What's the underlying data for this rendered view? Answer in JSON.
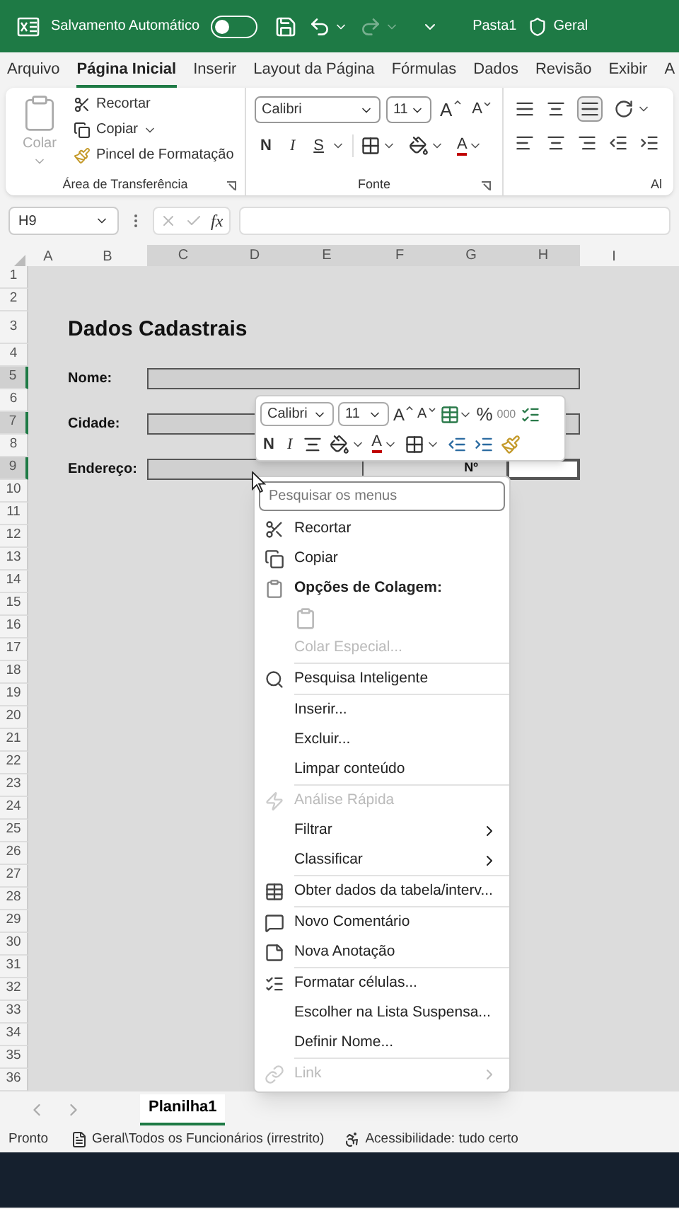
{
  "title_bar": {
    "autosave_label": "Salvamento Automático",
    "autosave_on": false,
    "file_name": "Pasta1",
    "sensitivity_label": "Geral"
  },
  "ribbon_tabs": [
    {
      "label": "Arquivo",
      "selected": false
    },
    {
      "label": "Página Inicial",
      "selected": true
    },
    {
      "label": "Inserir",
      "selected": false
    },
    {
      "label": "Layout da Página",
      "selected": false
    },
    {
      "label": "Fórmulas",
      "selected": false
    },
    {
      "label": "Dados",
      "selected": false
    },
    {
      "label": "Revisão",
      "selected": false
    },
    {
      "label": "Exibir",
      "selected": false
    },
    {
      "label": "A",
      "selected": false
    }
  ],
  "ribbon": {
    "clipboard": {
      "paste": "Colar",
      "paste_disabled": true,
      "cut": "Recortar",
      "copy": "Copiar",
      "format_painter": "Pincel de Formatação",
      "group_label": "Área de Transferência"
    },
    "font": {
      "font_name": "Calibri",
      "font_size": "11",
      "grow": "A",
      "shrink": "A",
      "bold": "N",
      "italic": "I",
      "underline": "S",
      "font_color": "A",
      "group_label": "Fonte"
    },
    "alignment": {
      "group_label": "Al"
    }
  },
  "formula_bar": {
    "name_box": "H9",
    "fx": "fx"
  },
  "columns": [
    {
      "label": "A",
      "selected": false
    },
    {
      "label": "B",
      "selected": false
    },
    {
      "label": "C",
      "selected": true
    },
    {
      "label": "D",
      "selected": true
    },
    {
      "label": "E",
      "selected": true
    },
    {
      "label": "F",
      "selected": true
    },
    {
      "label": "G",
      "selected": true
    },
    {
      "label": "H",
      "selected": true
    },
    {
      "label": "I",
      "selected": false
    }
  ],
  "rows": [
    {
      "label": "1",
      "selected": false
    },
    {
      "label": "2",
      "selected": false
    },
    {
      "label": "3",
      "selected": false
    },
    {
      "label": "4",
      "selected": false
    },
    {
      "label": "5",
      "selected": true
    },
    {
      "label": "6",
      "selected": false
    },
    {
      "label": "7",
      "selected": true
    },
    {
      "label": "8",
      "selected": false
    },
    {
      "label": "9",
      "selected": true
    },
    {
      "label": "10",
      "selected": false
    },
    {
      "label": "11",
      "selected": false
    },
    {
      "label": "12",
      "selected": false
    },
    {
      "label": "13",
      "selected": false
    },
    {
      "label": "14",
      "selected": false
    },
    {
      "label": "15",
      "selected": false
    },
    {
      "label": "16",
      "selected": false
    },
    {
      "label": "17",
      "selected": false
    },
    {
      "label": "18",
      "selected": false
    },
    {
      "label": "19",
      "selected": false
    },
    {
      "label": "20",
      "selected": false
    },
    {
      "label": "21",
      "selected": false
    },
    {
      "label": "22",
      "selected": false
    },
    {
      "label": "23",
      "selected": false
    },
    {
      "label": "24",
      "selected": false
    },
    {
      "label": "25",
      "selected": false
    },
    {
      "label": "26",
      "selected": false
    },
    {
      "label": "27",
      "selected": false
    },
    {
      "label": "28",
      "selected": false
    },
    {
      "label": "29",
      "selected": false
    },
    {
      "label": "30",
      "selected": false
    },
    {
      "label": "31",
      "selected": false
    },
    {
      "label": "32",
      "selected": false
    },
    {
      "label": "33",
      "selected": false
    },
    {
      "label": "34",
      "selected": false
    },
    {
      "label": "35",
      "selected": false
    },
    {
      "label": "36",
      "selected": false
    }
  ],
  "form": {
    "title": "Dados Cadastrais",
    "fields": [
      {
        "label": "Nome:"
      },
      {
        "label": "Cidade:"
      },
      {
        "label": "Endereço:",
        "number_label": "Nº"
      }
    ]
  },
  "mini_toolbar": {
    "font_name": "Calibri",
    "font_size": "11",
    "grow": "A",
    "shrink": "A",
    "percent": "%",
    "thousands": "000",
    "bold": "N",
    "italic": "I",
    "font_color": "A"
  },
  "context_menu": {
    "search_placeholder": "Pesquisar os menus",
    "items": [
      {
        "kind": "item",
        "label": "Recortar",
        "disabled": false,
        "submenu": false
      },
      {
        "kind": "item",
        "label": "Copiar",
        "disabled": false,
        "submenu": false
      },
      {
        "kind": "heading",
        "label": "Opções de Colagem:"
      },
      {
        "kind": "paste_option"
      },
      {
        "kind": "item",
        "label": "Colar Especial...",
        "disabled": true,
        "submenu": false
      },
      {
        "kind": "separator"
      },
      {
        "kind": "item",
        "label": "Pesquisa Inteligente",
        "disabled": false,
        "submenu": false
      },
      {
        "kind": "separator"
      },
      {
        "kind": "item",
        "label": "Inserir...",
        "disabled": false,
        "submenu": false
      },
      {
        "kind": "item",
        "label": "Excluir...",
        "disabled": false,
        "submenu": false
      },
      {
        "kind": "item",
        "label": "Limpar conteúdo",
        "disabled": false,
        "submenu": false
      },
      {
        "kind": "separator"
      },
      {
        "kind": "item",
        "label": "Análise Rápida",
        "disabled": true,
        "submenu": false
      },
      {
        "kind": "item",
        "label": "Filtrar",
        "disabled": false,
        "submenu": true
      },
      {
        "kind": "item",
        "label": "Classificar",
        "disabled": false,
        "submenu": true
      },
      {
        "kind": "separator"
      },
      {
        "kind": "item",
        "label": "Obter dados da tabela/interv...",
        "disabled": false,
        "submenu": false
      },
      {
        "kind": "separator"
      },
      {
        "kind": "item",
        "label": "Novo Comentário",
        "disabled": false,
        "submenu": false
      },
      {
        "kind": "item",
        "label": "Nova Anotação",
        "disabled": false,
        "submenu": false
      },
      {
        "kind": "separator"
      },
      {
        "kind": "item",
        "label": "Formatar células...",
        "disabled": false,
        "submenu": false
      },
      {
        "kind": "item",
        "label": "Escolher na Lista Suspensa...",
        "disabled": false,
        "submenu": false
      },
      {
        "kind": "item",
        "label": "Definir Nome...",
        "disabled": false,
        "submenu": false
      },
      {
        "kind": "separator"
      },
      {
        "kind": "item",
        "label": "Link",
        "disabled": true,
        "submenu": true
      }
    ]
  },
  "sheet_tabs": [
    {
      "label": "Planilha1",
      "selected": true
    }
  ],
  "status_bar": {
    "ready": "Pronto",
    "sensitivity": "Geral\\Todos os Funcionários (irrestrito)",
    "accessibility": "Acessibilidade: tudo certo"
  }
}
